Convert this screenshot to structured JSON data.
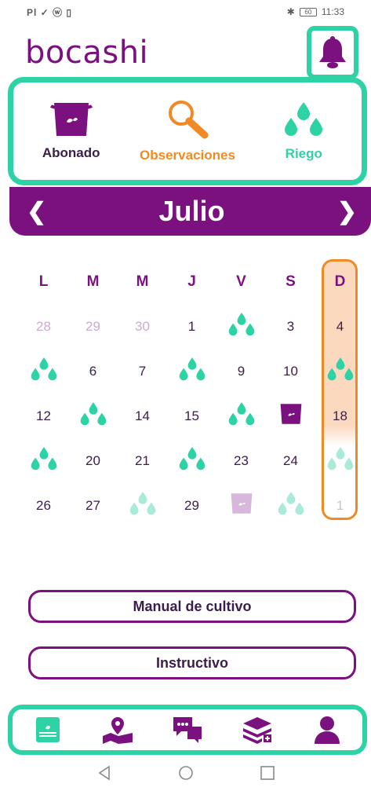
{
  "statusbar": {
    "left_text": "Pl ✓ ⓦ ▯",
    "time": "11:33",
    "battery": "60"
  },
  "header": {
    "title": "bocashi"
  },
  "actions": [
    {
      "label": "Abonado",
      "color": "#7a117f"
    },
    {
      "label": "Observaciones",
      "color": "#f08a24"
    },
    {
      "label": "Riego",
      "color": "#2ed3a5"
    }
  ],
  "calendar": {
    "month": "Julio",
    "prev": "❮",
    "next": "❯",
    "weekdays": [
      "L",
      "M",
      "M",
      "J",
      "V",
      "S",
      "D"
    ],
    "weeks": [
      [
        {
          "t": "28",
          "s": "muted"
        },
        {
          "t": "29",
          "s": "muted"
        },
        {
          "t": "30",
          "s": "muted"
        },
        {
          "t": "1"
        },
        {
          "icon": "water-drops-icon",
          "c": "#2ed3a5"
        },
        {
          "t": "3"
        },
        {
          "t": "4"
        }
      ],
      [
        {
          "icon": "water-drops-icon",
          "c": "#2ed3a5"
        },
        {
          "t": "6"
        },
        {
          "t": "7"
        },
        {
          "icon": "water-drops-icon",
          "c": "#2ed3a5"
        },
        {
          "t": "9"
        },
        {
          "t": "10"
        },
        {
          "icon": "water-drops-icon",
          "c": "#2ed3a5"
        }
      ],
      [
        {
          "t": "12"
        },
        {
          "icon": "water-drops-icon",
          "c": "#2ed3a5"
        },
        {
          "t": "14"
        },
        {
          "t": "15"
        },
        {
          "icon": "water-drops-icon",
          "c": "#2ed3a5"
        },
        {
          "icon": "fertilizer-bag-icon",
          "c": "#7a117f"
        },
        {
          "t": "18"
        }
      ],
      [
        {
          "icon": "water-drops-icon",
          "c": "#2ed3a5"
        },
        {
          "t": "20"
        },
        {
          "t": "21"
        },
        {
          "icon": "water-drops-icon",
          "c": "#2ed3a5"
        },
        {
          "t": "23"
        },
        {
          "t": "24"
        },
        {
          "icon": "water-drops-icon",
          "c": "#a9ead8"
        }
      ],
      [
        {
          "t": "26"
        },
        {
          "t": "27"
        },
        {
          "icon": "water-drops-icon",
          "c": "#a9ead8"
        },
        {
          "t": "29"
        },
        {
          "icon": "fertilizer-bag-icon",
          "c": "#d7b7dc"
        },
        {
          "icon": "water-drops-icon",
          "c": "#a9ead8"
        },
        {
          "t": "1",
          "s": "faint"
        }
      ]
    ]
  },
  "buttons": {
    "manual": "Manual de cultivo",
    "instructivo": "Instructivo"
  },
  "bottom_nav": [
    "field-icon",
    "map-pin-icon",
    "chat-icon",
    "add-layers-icon",
    "user-icon"
  ]
}
